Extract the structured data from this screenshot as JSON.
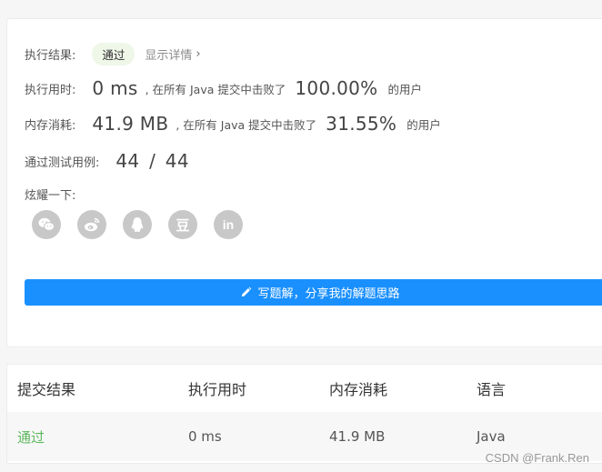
{
  "result": {
    "label": "执行结果:",
    "status": "通过",
    "details_link": "显示详情",
    "chevron": "›"
  },
  "runtime": {
    "label": "执行用时:",
    "value": "0 ms",
    "beat_text": ", 在所有 Java 提交中击败了",
    "percent": "100.00%",
    "users": "的用户"
  },
  "memory": {
    "label": "内存消耗:",
    "value": "41.9 MB",
    "beat_text": ", 在所有 Java 提交中击败了",
    "percent": "31.55%",
    "users": "的用户"
  },
  "tests": {
    "label": "通过测试用例:",
    "value": "44 / 44"
  },
  "share": {
    "label": "炫耀一下:",
    "icons": [
      "wechat-icon",
      "weibo-icon",
      "qq-icon",
      "douban-icon",
      "linkedin-icon"
    ],
    "douban_glyph": "豆",
    "linkedin_glyph": "in"
  },
  "write_solution_button": "写题解，分享我的解题思路",
  "table": {
    "headers": [
      "提交结果",
      "执行用时",
      "内存消耗",
      "语言"
    ],
    "row": [
      "通过",
      "0 ms",
      "41.9 MB",
      "Java"
    ]
  },
  "watermark": "CSDN @Frank.Ren",
  "colors": {
    "accent_blue": "#1a90ff",
    "pass_green": "#5cb85c",
    "badge_bg": "#eff7e9",
    "icon_gray": "#c8c8c8"
  }
}
